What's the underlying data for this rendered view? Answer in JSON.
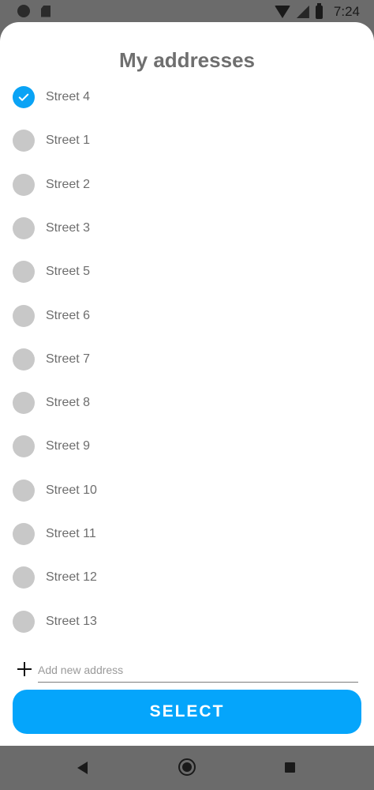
{
  "status_bar": {
    "time": "7:24"
  },
  "sheet": {
    "title": "My addresses",
    "addresses": [
      {
        "label": "Street 4",
        "selected": true
      },
      {
        "label": "Street 1",
        "selected": false
      },
      {
        "label": "Street 2",
        "selected": false
      },
      {
        "label": "Street 3",
        "selected": false
      },
      {
        "label": "Street 5",
        "selected": false
      },
      {
        "label": "Street 6",
        "selected": false
      },
      {
        "label": "Street 7",
        "selected": false
      },
      {
        "label": "Street 8",
        "selected": false
      },
      {
        "label": "Street 9",
        "selected": false
      },
      {
        "label": "Street 10",
        "selected": false
      },
      {
        "label": "Street 11",
        "selected": false
      },
      {
        "label": "Street 12",
        "selected": false
      },
      {
        "label": "Street 13",
        "selected": false
      }
    ],
    "add_address": {
      "placeholder": "Add new address",
      "value": ""
    },
    "select_label": "SELECT"
  },
  "colors": {
    "accent": "#05a5fb",
    "radio_off": "#c8c8c8",
    "title": "#6f6f6f"
  },
  "icons": {
    "status": [
      "status-dot-icon",
      "sd-card-icon",
      "wifi-icon",
      "signal-icon",
      "battery-icon"
    ],
    "nav": [
      "back-icon",
      "home-icon",
      "recents-icon"
    ]
  }
}
